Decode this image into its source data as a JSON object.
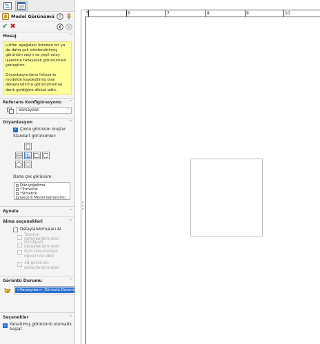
{
  "header": {
    "title": "Model Görünümü",
    "tabs": [
      "feature-manager-tab",
      "property-manager-tab"
    ]
  },
  "message": {
    "title": "Mesaj",
    "paragraph1": "Lütfen aşağıdaki listeden bir ya da daha çok isimlendirilmiş görünüm seçin ve yeşil onay işaretine tıklayarak görünümleri yerleştirin.",
    "paragraph2": "Oryantasyonların listesinin modelde kaydedilmiş olan detaylandırma görünümlerine denk geldiğine dikkat edin."
  },
  "reference": {
    "title": "Referans Konfigürasyonu",
    "value": "Varsayılan"
  },
  "orientation": {
    "title": "Oryantasyon",
    "multi_view_label": "Çoklu görünüm oluştur",
    "multi_view_checked": true,
    "standard_views_label": "Standart görünümler:",
    "more_views_label": "Daha çok görünüm:",
    "more_views": [
      "Düz çoğaltma",
      "*Trimetrik",
      "*Simetrik",
      "Geçerli Model Görünümü"
    ]
  },
  "mirror": {
    "title": "Aynala"
  },
  "import": {
    "title": "Alma seçenekleri",
    "annotations_label": "Detaylandırmaları Al",
    "options": [
      "Tasarım detaylandırmaları",
      "DimXpert detaylandırmaları",
      "Gizli unsurlardan öğeleri de ekle",
      "3B görünüm detaylandırmaları"
    ]
  },
  "display_state": {
    "title": "Görüntü Durumu",
    "value": "<Varsayılan>_Görüntü Durumu-1"
  },
  "options": {
    "title": "Seçenekler",
    "auto_start_label": "Yansıtılmış görünümü otomatik başlat",
    "auto_start_checked": true
  },
  "ruler": {
    "labels": [
      "5",
      "6",
      "7",
      "8",
      "9",
      "10"
    ]
  },
  "colors": {
    "message_bg": "#ffff99",
    "ok": "#1e9b3b",
    "cancel": "#cc2020",
    "selection": "#2a6fd0"
  }
}
